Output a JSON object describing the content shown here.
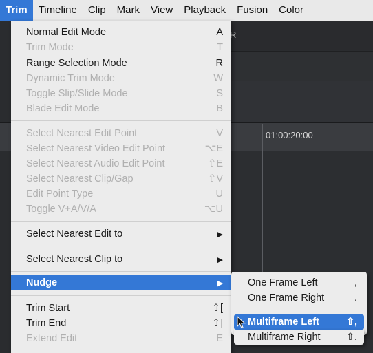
{
  "menubar": {
    "items": [
      "Trim",
      "Timeline",
      "Clip",
      "Mark",
      "View",
      "Playback",
      "Fusion",
      "Color"
    ],
    "active_index": 0
  },
  "background": {
    "partial_label": "R",
    "timecode": "01:00:20:00"
  },
  "trim_menu": {
    "items": [
      {
        "label": "Normal Edit Mode",
        "shortcut": "A",
        "enabled": true
      },
      {
        "label": "Trim Mode",
        "shortcut": "T",
        "enabled": false
      },
      {
        "label": "Range Selection Mode",
        "shortcut": "R",
        "enabled": true
      },
      {
        "label": "Dynamic Trim Mode",
        "shortcut": "W",
        "enabled": false
      },
      {
        "label": "Toggle Slip/Slide Mode",
        "shortcut": "S",
        "enabled": false
      },
      {
        "label": "Blade Edit Mode",
        "shortcut": "B",
        "enabled": false
      },
      {
        "label": "Select Nearest Edit Point",
        "shortcut": "V",
        "enabled": false
      },
      {
        "label": "Select Nearest Video Edit Point",
        "shortcut": "⌥E",
        "enabled": false
      },
      {
        "label": "Select Nearest Audio Edit Point",
        "shortcut": "⇧E",
        "enabled": false
      },
      {
        "label": "Select Nearest Clip/Gap",
        "shortcut": "⇧V",
        "enabled": false
      },
      {
        "label": "Edit Point Type",
        "shortcut": "U",
        "enabled": false
      },
      {
        "label": "Toggle V+A/V/A",
        "shortcut": "⌥U",
        "enabled": false
      },
      {
        "label": "Select Nearest Edit to",
        "submenu": true,
        "enabled": true
      },
      {
        "label": "Select Nearest Clip to",
        "submenu": true,
        "enabled": true
      },
      {
        "label": "Nudge",
        "submenu": true,
        "enabled": true,
        "highlighted": true
      },
      {
        "label": "Trim Start",
        "shortcut": "⇧[",
        "enabled": true
      },
      {
        "label": "Trim End",
        "shortcut": "⇧]",
        "enabled": true
      },
      {
        "label": "Extend Edit",
        "shortcut": "E",
        "enabled": false
      }
    ]
  },
  "nudge_submenu": {
    "items": [
      {
        "label": "One Frame Left",
        "shortcut": ","
      },
      {
        "label": "One Frame Right",
        "shortcut": "."
      },
      {
        "label": "Multiframe Left",
        "shortcut": "⇧,",
        "highlighted": true
      },
      {
        "label": "Multiframe Right",
        "shortcut": "⇧."
      }
    ]
  },
  "icons": {
    "submenu_arrow": "▶",
    "cursor": "mouse-pointer-icon"
  },
  "colors": {
    "highlight": "#3478d6",
    "menu_bg": "#ececec",
    "disabled_text": "#b0b0b0"
  }
}
